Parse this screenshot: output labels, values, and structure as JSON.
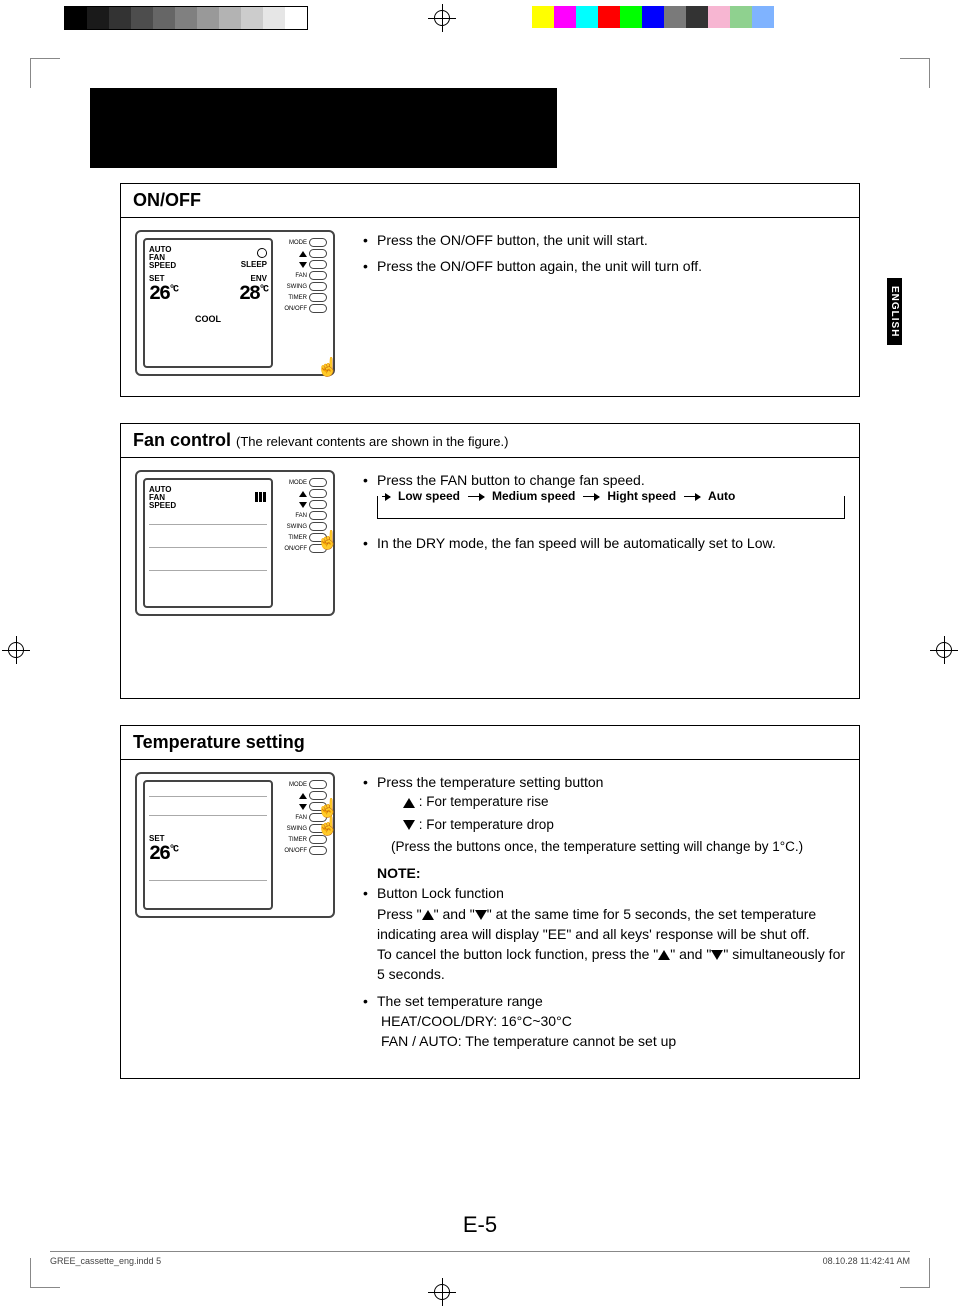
{
  "printer_bar": {
    "grays": [
      "#000",
      "#1a1a1a",
      "#333",
      "#4d4d4d",
      "#666",
      "#808080",
      "#999",
      "#b3b3b3",
      "#ccc",
      "#e6e6e6",
      "#fff"
    ],
    "colors": [
      "#fff",
      "#ff0",
      "#f0f",
      "#0ff",
      "#f00",
      "#0f0",
      "#00f",
      "#7a7a7a",
      "#333",
      "#f7b6d2",
      "#8fd18f",
      "#7fb3ff"
    ]
  },
  "lang_tab": "ENGLISH",
  "page_number": "E-5",
  "footer": {
    "left": "GREE_cassette_eng.indd   5",
    "right": "08.10.28   11:42:41 AM"
  },
  "remote": {
    "btn_labels": [
      "MODE",
      "▲",
      "▼",
      "FAN",
      "SWING",
      "TIMER",
      "ON/OFF"
    ],
    "screen1": {
      "auto_fan_speed": "AUTO\nFAN\nSPEED",
      "sleep": "SLEEP",
      "set_label": "SET",
      "set_temp": "26",
      "env_label": "ENV",
      "env_temp": "28",
      "mode": "COOL",
      "unit": "°C"
    },
    "screen2": {
      "auto_fan_speed": "AUTO\nFAN\nSPEED"
    },
    "screen3": {
      "set_label": "SET",
      "set_temp": "26",
      "unit": "°C"
    }
  },
  "sections": {
    "onoff": {
      "title": "ON/OFF",
      "b1": "Press the ON/OFF button, the unit will start.",
      "b2": "Press the ON/OFF button again, the unit will turn off."
    },
    "fan": {
      "title": "Fan control",
      "subtitle": "(The relevant contents are shown in the figure.)",
      "b1": "Press the FAN button to change fan speed.",
      "cycle": [
        "Low speed",
        "Medium speed",
        "Hight speed",
        "Auto"
      ],
      "b2": "In the DRY mode, the fan speed will be automatically set to Low."
    },
    "temp": {
      "title": "Temperature setting",
      "b1": "Press the temperature setting button",
      "rise": ": For temperature rise",
      "drop": ": For temperature drop",
      "press_once": "(Press the buttons once, the temperature setting will change by 1°C.)",
      "note_label": "NOTE:",
      "lock_title": "Button Lock function",
      "lock1_a": "Press \"",
      "lock1_b": "\" and \"",
      "lock1_c": "\" at the same time for 5 seconds, the set temperature indicating area will display \"EE\" and all keys' response will be shut off.",
      "lock2_a": "To cancel the button lock function, press the \"",
      "lock2_b": "\" and \"",
      "lock2_c": "\" simultaneously for 5 seconds.",
      "range_title": "The set temperature range",
      "range1": "HEAT/COOL/DRY: 16°C~30°C",
      "range2": "FAN / AUTO: The temperature cannot be set up"
    }
  }
}
